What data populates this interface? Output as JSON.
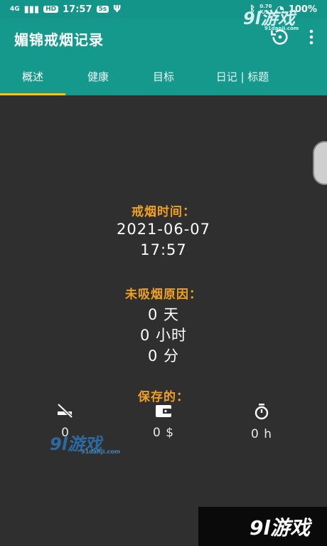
{
  "status_bar": {
    "network": "4G",
    "hd": "HD",
    "time": "17:57",
    "speed": "0.70\nK/s",
    "battery": "100%"
  },
  "app": {
    "title": "媚锦戒烟记录"
  },
  "tabs": [
    {
      "label": "概述",
      "active": true
    },
    {
      "label": "健康",
      "active": false
    },
    {
      "label": "目标",
      "active": false
    },
    {
      "label": "日记 | 标题",
      "active": false
    }
  ],
  "quit_time": {
    "title": "戒烟时间：",
    "date": "2021-06-07",
    "time": "17:57"
  },
  "not_smoked": {
    "title": "未吸烟原因：",
    "days": "0 天",
    "hours": "0 小时",
    "minutes": "0 分"
  },
  "saved": {
    "title": "保存的：",
    "cigarettes": "0",
    "money": "0 $",
    "hours": "0 h"
  },
  "watermarks": {
    "top": "9l游戏",
    "top_sub": "91danji.com",
    "middle": "9l游戏",
    "middle_sub": "91danji.com",
    "bottom": "9l游戏"
  },
  "colors": {
    "primary": "#15998d",
    "accent": "#ffc107",
    "heading": "#f0a020",
    "background": "#2f2f2f"
  },
  "icons": {
    "history": "history-icon",
    "more": "more-vert-icon",
    "no_smoking": "no-smoking-icon",
    "wallet": "wallet-icon",
    "timer": "timer-icon"
  }
}
